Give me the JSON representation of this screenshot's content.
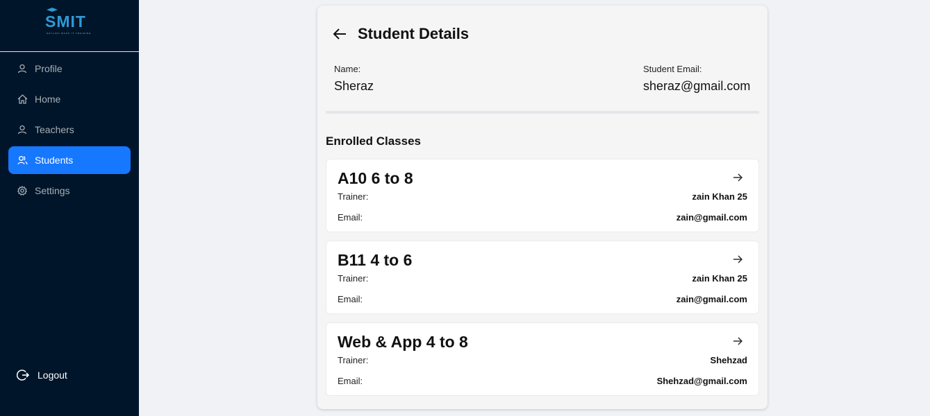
{
  "sidebar": {
    "logo_text": "SMIT",
    "logo_tagline": "SAYLANI MASS IT TRAINING",
    "items": [
      {
        "label": "Profile",
        "icon": "user-icon"
      },
      {
        "label": "Home",
        "icon": "home-icon"
      },
      {
        "label": "Teachers",
        "icon": "user-icon"
      },
      {
        "label": "Students",
        "icon": "students-icon",
        "active": true
      },
      {
        "label": "Settings",
        "icon": "gear-icon"
      }
    ],
    "logout_label": "Logout"
  },
  "main": {
    "title": "Student Details",
    "name_label": "Name:",
    "name_value": "Sheraz",
    "email_label": "Student Email:",
    "email_value": "sheraz@gmail.com",
    "enrolled_title": "Enrolled Classes",
    "trainer_label": "Trainer:",
    "class_email_label": "Email:",
    "classes": [
      {
        "name": "A10 6 to 8",
        "trainer": "zain Khan 25",
        "email": "zain@gmail.com"
      },
      {
        "name": "B11 4 to 6",
        "trainer": "zain Khan 25",
        "email": "zain@gmail.com"
      },
      {
        "name": "Web & App 4 to 8",
        "trainer": "Shehzad",
        "email": "Shehzad@gmail.com"
      }
    ]
  },
  "colors": {
    "sidebar_bg": "#001529",
    "accent": "#1677ff",
    "card_bg": "#f5f5f5"
  }
}
